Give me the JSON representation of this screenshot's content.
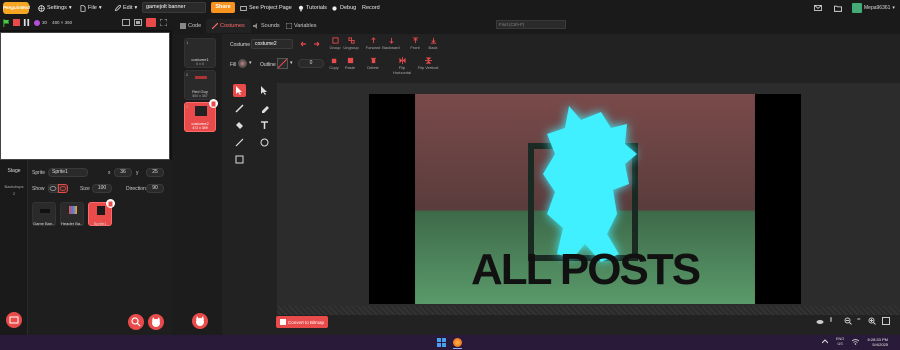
{
  "menubar": {
    "logo": "PenguinMod",
    "settings": "Settings",
    "file": "File",
    "edit": "Edit",
    "project_title": "gamejolt banner",
    "share": "Share",
    "see_project_page": "See Project Page",
    "tutorials": "Tutorials",
    "debug": "Debug",
    "record": "Record",
    "username": "Mepa96361"
  },
  "stage_header": {
    "fps": "30",
    "size_readout": "480 × 360"
  },
  "sprite_info": {
    "sprite_label": "Sprite",
    "sprite_name": "Sprite1",
    "x_label": "x",
    "x_value": "36",
    "y_label": "y",
    "y_value": "25",
    "show_label": "Show",
    "size_label": "Size",
    "size_value": "100",
    "direction_label": "Direction",
    "direction_value": "90"
  },
  "stage_panel": {
    "label": "Stage",
    "backdrops_label": "Backdrops",
    "backdrops_count": "2"
  },
  "sprites": [
    {
      "name": "Game Ban..."
    },
    {
      "name": "Header Ba..."
    },
    {
      "name": "Sprite1"
    }
  ],
  "tabs": {
    "code": "Code",
    "costumes": "Costumes",
    "sounds": "Sounds",
    "variables": "Variables",
    "find_placeholder": "Find (Ctrl+F)"
  },
  "costumes": [
    {
      "num": "1",
      "name": "costume1",
      "size": "0 x 0"
    },
    {
      "num": "2",
      "name": "Red Guy",
      "size": "500 x 387"
    },
    {
      "num": "3",
      "name": "costume2",
      "size": "472 x 359"
    }
  ],
  "toolbar": {
    "costume_label": "Costume",
    "costume_name": "costume2",
    "group": "Group",
    "ungroup": "Ungroup",
    "forward": "Forward",
    "backward": "Backward",
    "front": "Front",
    "back": "Back",
    "fill_label": "Fill",
    "outline_label": "Outline",
    "outline_value": "0",
    "copy": "Copy",
    "paste": "Paste",
    "delete": "Delete",
    "flip_horizontal": "Flip Horizontal",
    "flip_vertical": "Flip Vertical"
  },
  "canvas": {
    "art_text": "ALL POSTS",
    "convert_button": "Convert to Bitmap"
  },
  "taskbar": {
    "lang": "ENG",
    "lang_sub": "US",
    "time": "8:28:33 PM",
    "date": "5/4/2025"
  },
  "colors": {
    "accent": "#e94b4b",
    "share": "#f7931e",
    "glow": "#3ff0ff"
  }
}
